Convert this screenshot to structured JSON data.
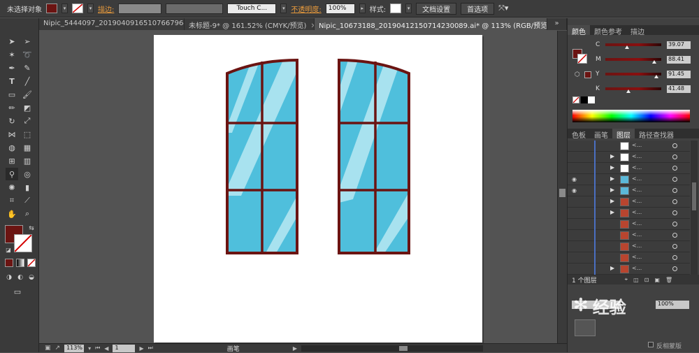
{
  "control_bar": {
    "selection_label": "未选择对象",
    "stroke_link_label": "描边:",
    "brush_value": "Touch C...",
    "opacity_label": "不透明度:",
    "opacity_value": "100%",
    "style_label": "样式:",
    "doc_settings_button": "文档设置",
    "preferences_button": "首选项",
    "fill_color": "#6b1412"
  },
  "tabs": [
    {
      "label": "Nipic_5444097_20190409165107667964.ai*",
      "close": "✕",
      "active": false
    },
    {
      "label": "未标题-9* @ 161.52% (CMYK/预览)",
      "close": "✕",
      "active": false
    },
    {
      "label": "Nipic_10673188_20190412150714230089.ai* @ 113% (RGB/预览)",
      "close": "✕",
      "active": true
    }
  ],
  "tabs_overflow": "»",
  "status_bar": {
    "zoom_value": "113%",
    "page_value": "1",
    "mode_label": "画笔"
  },
  "color_panel": {
    "tabs": [
      "颜色",
      "颜色参考",
      "描边"
    ],
    "channels": [
      {
        "letter": "C",
        "value": "39.07",
        "level": 0.39
      },
      {
        "letter": "M",
        "value": "88.41",
        "level": 0.88
      },
      {
        "letter": "Y",
        "value": "91.45",
        "level": 0.91
      },
      {
        "letter": "K",
        "value": "41.48",
        "level": 0.41
      }
    ]
  },
  "layers_panel": {
    "tabs": [
      "色板",
      "画笔",
      "图层",
      "路径查找器"
    ],
    "rows": [
      {
        "visible": false,
        "arrow": "",
        "name": "<...",
        "thumb": "#ffffff"
      },
      {
        "visible": false,
        "arrow": "▶",
        "name": "<...",
        "thumb": "#ffffff"
      },
      {
        "visible": false,
        "arrow": "▶",
        "name": "<...",
        "thumb": "#ffffff"
      },
      {
        "visible": true,
        "arrow": "▶",
        "name": "<...",
        "thumb": "#5bb8d8"
      },
      {
        "visible": true,
        "arrow": "▶",
        "name": "<...",
        "thumb": "#5bb8d8"
      },
      {
        "visible": false,
        "arrow": "▶",
        "name": "<...",
        "thumb": "#b8452f"
      },
      {
        "visible": false,
        "arrow": "▶",
        "name": "<...",
        "thumb": "#b8452f"
      },
      {
        "visible": false,
        "arrow": "",
        "name": "<...",
        "thumb": "#b8452f"
      },
      {
        "visible": false,
        "arrow": "",
        "name": "<...",
        "thumb": "#b8452f"
      },
      {
        "visible": false,
        "arrow": "",
        "name": "<...",
        "thumb": "#b8452f"
      },
      {
        "visible": false,
        "arrow": "",
        "name": "<...",
        "thumb": "#b8452f"
      },
      {
        "visible": false,
        "arrow": "▶",
        "name": "<...",
        "thumb": "#b8452f"
      }
    ],
    "footer_label": "1 个图层"
  },
  "bottom_panel": {
    "opacity_value": "100%",
    "mask_label": "反相蒙版"
  },
  "watermark": {
    "text": "经验"
  },
  "colors": {
    "window_frame": "#6b1412",
    "glass": "#4fbfdc",
    "glare": "#a8e2ef"
  }
}
